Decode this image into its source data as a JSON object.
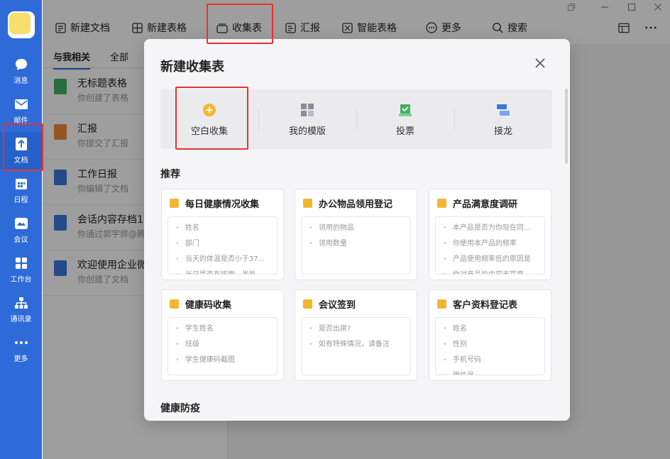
{
  "rail": {
    "items": [
      {
        "label": "消息",
        "icon": "message-icon"
      },
      {
        "label": "邮件",
        "icon": "mail-icon"
      },
      {
        "label": "文档",
        "icon": "document-icon"
      },
      {
        "label": "日程",
        "icon": "calendar-icon"
      },
      {
        "label": "会议",
        "icon": "meeting-icon"
      },
      {
        "label": "工作台",
        "icon": "workbench-icon"
      },
      {
        "label": "通讯录",
        "icon": "contacts-icon"
      },
      {
        "label": "更多",
        "icon": "more-dots-icon"
      }
    ],
    "active": "文档"
  },
  "toolbar": {
    "items": [
      {
        "label": "新建文档",
        "icon": "doc-icon"
      },
      {
        "label": "新建表格",
        "icon": "table-icon"
      },
      {
        "label": "收集表",
        "icon": "collect-icon"
      },
      {
        "label": "汇报",
        "icon": "report-icon"
      },
      {
        "label": "智能表格",
        "icon": "smart-table-icon"
      },
      {
        "label": "更多",
        "icon": "more-icon"
      },
      {
        "label": "搜索",
        "icon": "search-icon"
      }
    ]
  },
  "doclist": {
    "tabs": [
      "与我相关",
      "全部"
    ],
    "rows": [
      {
        "title": "无标题表格",
        "sub": "你创建了表格",
        "color": "#3fb063"
      },
      {
        "title": "汇报",
        "sub": "你提交了汇报",
        "color": "#f08a3a"
      },
      {
        "title": "工作日报",
        "sub": "你编辑了文档",
        "color": "#3a78dd"
      },
      {
        "title": "会话内容存档1",
        "sub": "你通过郭宇骅@腾",
        "color": "#3a78dd"
      },
      {
        "title": "欢迎使用企业微",
        "sub": "你创建了文档",
        "color": "#3a78dd"
      }
    ]
  },
  "modal": {
    "title": "新建收集表",
    "types": [
      {
        "label": "空白收集",
        "icon": "plus-circle-icon"
      },
      {
        "label": "我的模版",
        "icon": "template-grid-icon"
      },
      {
        "label": "投票",
        "icon": "vote-icon"
      },
      {
        "label": "接龙",
        "icon": "chain-icon"
      }
    ],
    "section_recommend": "推荐",
    "section_health": "健康防疫",
    "cards": [
      {
        "title": "每日健康情况收集",
        "lines": [
          "姓名",
          "部门",
          "当天的体温是否小于37...",
          "当日是否有咳嗽、发热..."
        ]
      },
      {
        "title": "办公物品领用登记",
        "lines": [
          "领用的物品",
          "领用数量"
        ]
      },
      {
        "title": "产品满意度调研",
        "lines": [
          "本产品是否为你现在同...",
          "你使用本产品的频率",
          "产品使用频率低的原因是",
          "你对产品的内容丰富度..."
        ]
      },
      {
        "title": "健康码收集",
        "lines": [
          "学生姓名",
          "班级",
          "学生健康码截图"
        ]
      },
      {
        "title": "会议签到",
        "lines": [
          "是否出席?",
          "如有特殊情况，请备注"
        ]
      },
      {
        "title": "客户资料登记表",
        "lines": [
          "姓名",
          "性别",
          "手机号码",
          "微信号"
        ]
      }
    ]
  },
  "colors": {
    "rail": "#2f6bd8",
    "highlight": "#e8322c",
    "check": "#f4b632"
  }
}
